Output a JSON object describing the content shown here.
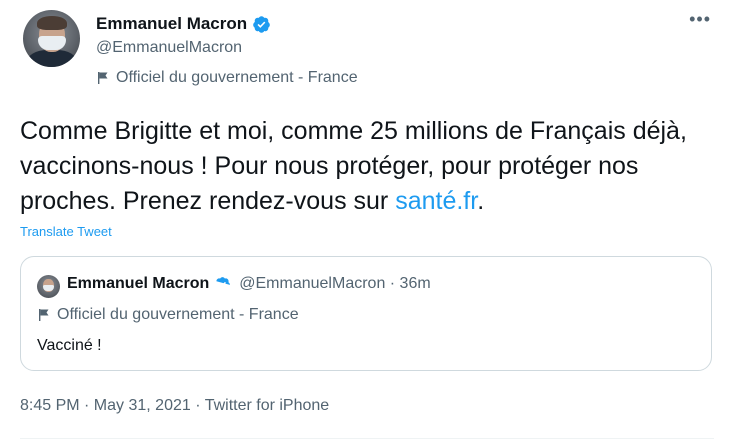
{
  "author": {
    "name": "Emmanuel Macron",
    "handle": "@EmmanuelMacron",
    "label": "Officiel du gouvernement - France"
  },
  "tweet": {
    "text": "Comme Brigitte et moi, comme 25 millions de Français déjà, vaccinons-nous ! Pour nous protéger, pour protéger nos proches. Prenez rendez-vous sur ",
    "link_text": "santé.fr",
    "text_end": ".",
    "translate_label": "Translate Tweet"
  },
  "quote": {
    "name": "Emmanuel Macron",
    "meta": "@EmmanuelMacron · 36m",
    "label": "Officiel du gouvernement - France",
    "text": "Vacciné !"
  },
  "footer": {
    "timestamp": "8:45 PM · May 31, 2021 · Twitter for iPhone"
  },
  "icons": {
    "more": "more-icon",
    "verified": "verified-badge-icon",
    "flag": "flag-icon"
  },
  "colors": {
    "accent": "#1d9bf0",
    "muted": "#536471",
    "text": "#0f1419",
    "border": "#cfd9de"
  }
}
